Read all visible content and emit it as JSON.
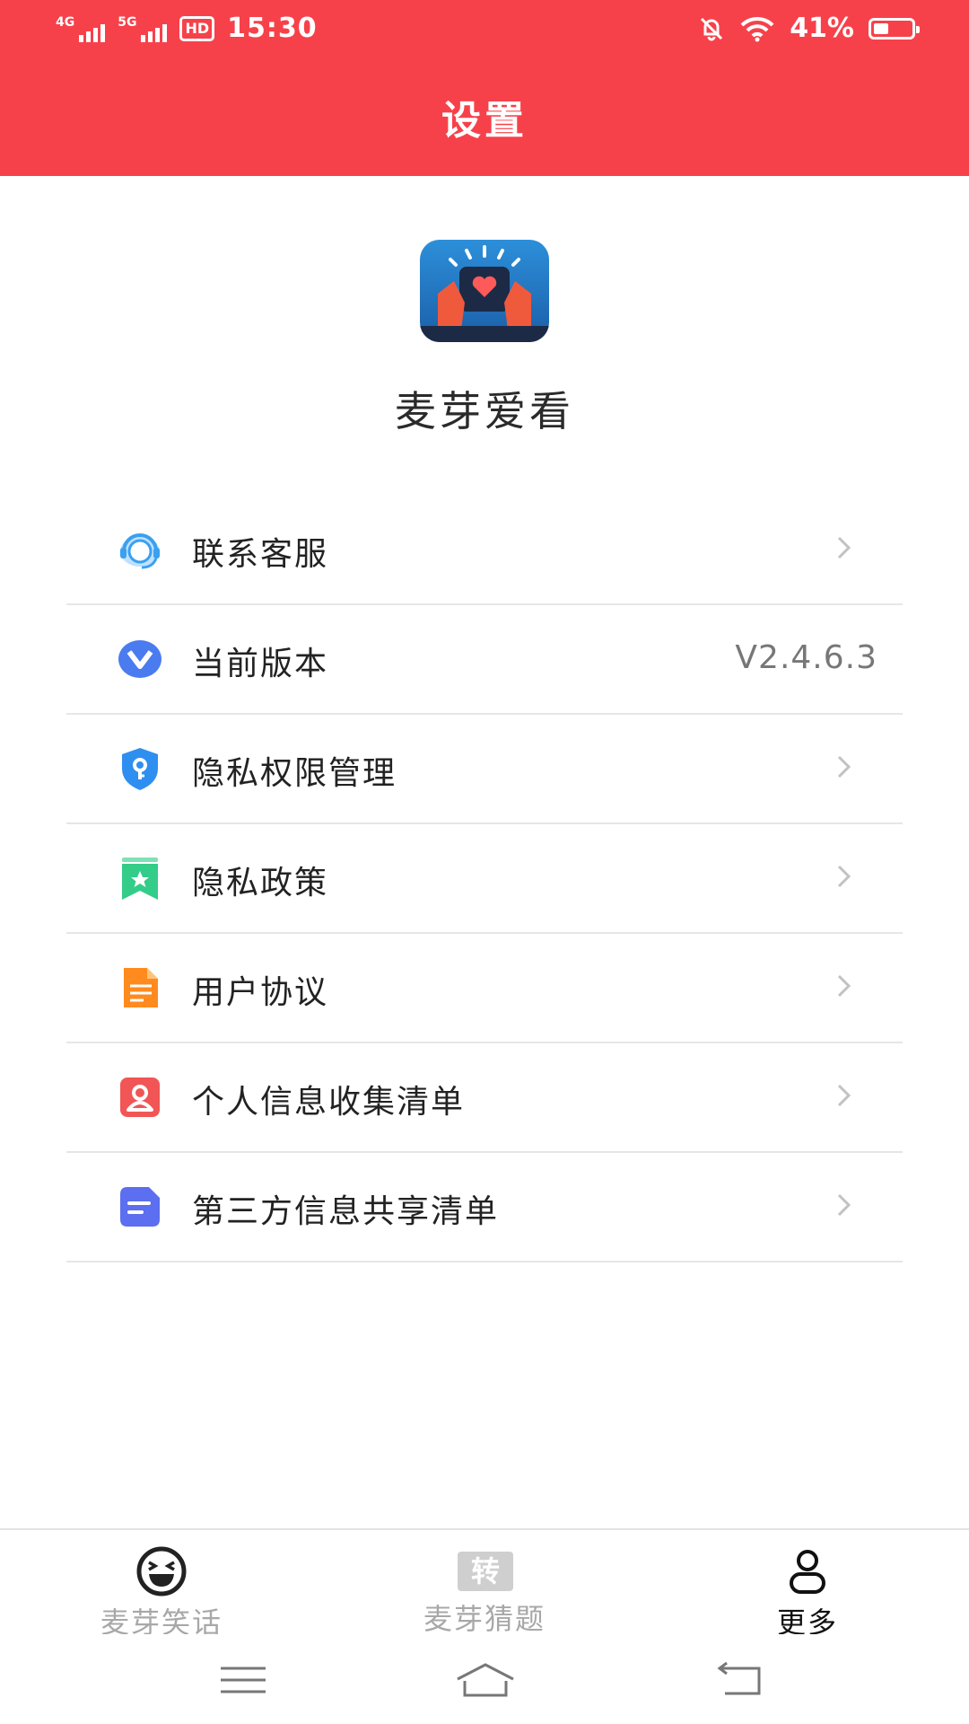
{
  "status_bar": {
    "net1": "4G",
    "net2": "5G",
    "hd": "HD",
    "time": "15:30",
    "battery": "41%",
    "battery_level": 0.41
  },
  "header": {
    "title": "设置"
  },
  "app": {
    "name": "麦芽爱看"
  },
  "menu": [
    {
      "label": "联系客服",
      "icon": "headset-icon",
      "color": "#3aa0f0"
    },
    {
      "label": "当前版本",
      "icon": "version-v-icon",
      "color": "#4a7cf0",
      "value": "V2.4.6.3"
    },
    {
      "label": "隐私权限管理",
      "icon": "shield-key-icon",
      "color": "#2f8ff0"
    },
    {
      "label": "隐私政策",
      "icon": "bookmark-star-icon",
      "color": "#33cc88"
    },
    {
      "label": "用户协议",
      "icon": "document-icon",
      "color": "#ff8a1e"
    },
    {
      "label": "个人信息收集清单",
      "icon": "person-card-icon",
      "color": "#f25555"
    },
    {
      "label": "第三方信息共享清单",
      "icon": "list-card-icon",
      "color": "#5b6ff0"
    }
  ],
  "tabs": [
    {
      "label": "麦芽笑话",
      "icon": "laughing-face-icon",
      "active": false
    },
    {
      "label": "麦芽猜题",
      "icon": "zhuan-badge-icon",
      "badge_text": "转",
      "active": false
    },
    {
      "label": "更多",
      "icon": "person-icon",
      "active": true
    }
  ],
  "colors": {
    "header_bg": "#f7414a",
    "tab_inactive": "#a8a8a8",
    "tab_active": "#111111"
  }
}
